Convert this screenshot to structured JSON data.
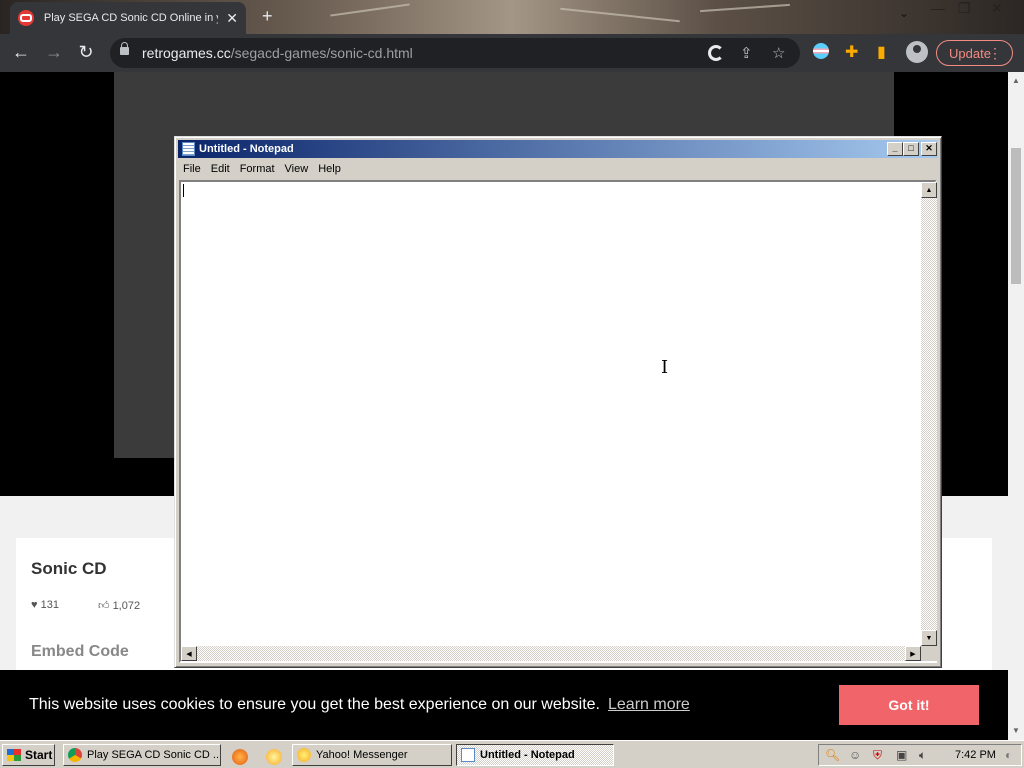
{
  "browser": {
    "tab_title": "Play SEGA CD Sonic CD Online in your browser",
    "url_host": "retrogames.cc",
    "url_path": "/segacd-games/sonic-cd.html",
    "update_label": "Update"
  },
  "page": {
    "game_title": "Sonic CD",
    "favorites": "131",
    "likes": "1,072",
    "embed_title": "Embed Code"
  },
  "cookie": {
    "message": "This website uses cookies to ensure you get the best experience on our website.",
    "learn_more": "Learn more",
    "button": "Got it!"
  },
  "notepad": {
    "title": "Untitled - Notepad",
    "menu": [
      "File",
      "Edit",
      "Format",
      "View",
      "Help"
    ],
    "content": ""
  },
  "taskbar": {
    "start": "Start",
    "tasks": [
      {
        "label": "Play SEGA CD Sonic CD ..."
      },
      {
        "label": "Yahoo! Messenger"
      },
      {
        "label": "Untitled - Notepad"
      }
    ],
    "clock": "7:42 PM"
  },
  "colors": {
    "cookie_button": "#f1646a",
    "update_accent": "#f28b82",
    "win_title_start": "#0a246a"
  }
}
